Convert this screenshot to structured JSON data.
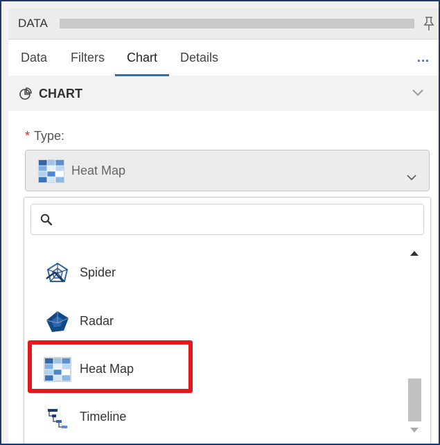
{
  "panel": {
    "title": "DATA"
  },
  "tabs": [
    {
      "label": "Data"
    },
    {
      "label": "Filters"
    },
    {
      "label": "Chart"
    },
    {
      "label": "Details"
    }
  ],
  "active_tab": "Chart",
  "more_label": "...",
  "section": {
    "title": "CHART"
  },
  "type_field": {
    "required_marker": "*",
    "label": "Type:",
    "selected_value": "Heat Map"
  },
  "dropdown": {
    "search_placeholder": "",
    "options": [
      {
        "label": "Spider",
        "icon": "spider-chart-icon"
      },
      {
        "label": "Radar",
        "icon": "radar-chart-icon"
      },
      {
        "label": "Heat Map",
        "icon": "heat-map-icon"
      },
      {
        "label": "Timeline",
        "icon": "timeline-icon"
      }
    ],
    "highlighted_option": "Heat Map"
  },
  "colors": {
    "accent": "#2a6ebb",
    "highlight": "#e5181b",
    "required": "#d62b2b",
    "frame_border": "#1f3a68"
  }
}
